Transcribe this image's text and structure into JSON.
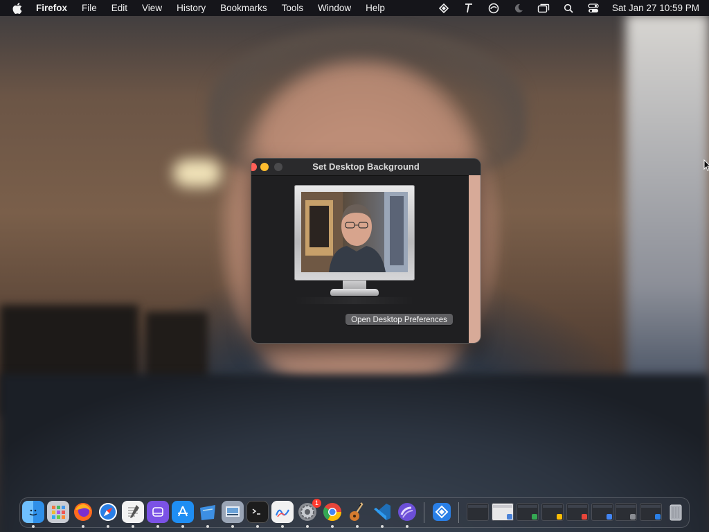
{
  "menubar": {
    "app_name": "Firefox",
    "menus": [
      "File",
      "Edit",
      "View",
      "History",
      "Bookmarks",
      "Tools",
      "Window",
      "Help"
    ],
    "status_icons": [
      "dropbox-icon",
      "typeface-icon",
      "edge-icon",
      "moon-icon",
      "screens-icon",
      "search-icon",
      "control-center-icon"
    ],
    "clock": "Sat Jan 27  10:59 PM"
  },
  "dialog": {
    "title": "Set Desktop Background",
    "open_prefs_label": "Open Desktop Preferences"
  },
  "dock": {
    "apps": [
      {
        "name": "finder-icon",
        "color": "#2f8fe8"
      },
      {
        "name": "launchpad-icon",
        "color": "#c9ccd3"
      },
      {
        "name": "firefox-icon",
        "color": "#ff6a1f"
      },
      {
        "name": "safari-icon",
        "color": "#2a7fe6"
      },
      {
        "name": "textedit-icon",
        "color": "#f3f3f3"
      },
      {
        "name": "podcasts-like-icon",
        "color": "#7b52e6"
      },
      {
        "name": "app-store-icon",
        "color": "#1f8ef3"
      },
      {
        "name": "xcode-like-icon",
        "color": "#3d8fe3"
      },
      {
        "name": "preview-icon",
        "color": "#9aa5b6"
      },
      {
        "name": "terminal-icon",
        "color": "#1c1c1c"
      },
      {
        "name": "freeform-icon",
        "color": "#f1f1f1"
      },
      {
        "name": "system-settings-icon",
        "color": "#8a8d93"
      },
      {
        "name": "chrome-icon",
        "color": "#e7453a"
      },
      {
        "name": "garageband-icon",
        "color": "#d57b2f"
      },
      {
        "name": "vscode-icon",
        "color": "#1f6fb8"
      },
      {
        "name": "arc-icon",
        "color": "#c8b7f3"
      },
      {
        "name": "dropbox-like-icon",
        "color": "#2a7fe6"
      }
    ],
    "settings_badge": "1"
  }
}
